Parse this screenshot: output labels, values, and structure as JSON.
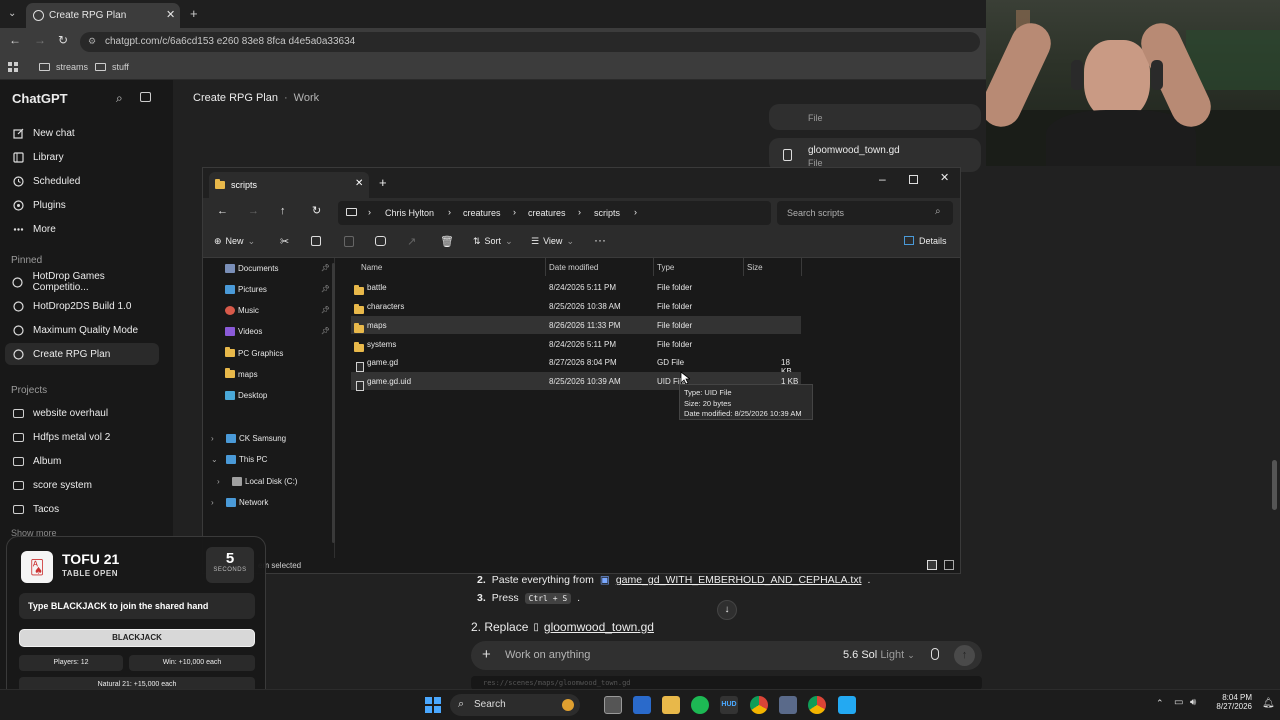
{
  "browser": {
    "tab_title": "Create RPG Plan",
    "url": "chatgpt.com/c/6a6cd153 e260 83e8 8fca d4e5a0a33634",
    "bookmarks": [
      "streams",
      "stuff"
    ]
  },
  "sidebar": {
    "app_title": "ChatGPT",
    "nav": [
      {
        "label": "New chat",
        "icon": "edit-icon"
      },
      {
        "label": "Library",
        "icon": "library-icon"
      },
      {
        "label": "Scheduled",
        "icon": "clock-icon"
      },
      {
        "label": "Plugins",
        "icon": "plugins-icon"
      },
      {
        "label": "More",
        "icon": "more-icon"
      }
    ],
    "pinned_heading": "Pinned",
    "pinned": [
      "HotDrop Games Competitio...",
      "HotDrop2DS Build 1.0",
      "Maximum Quality Mode",
      "Create RPG Plan"
    ],
    "projects_heading": "Projects",
    "projects": [
      "website overhaul",
      "Hdfps metal vol 2",
      "Album",
      "score system",
      "Tacos"
    ],
    "show_more": "Show more"
  },
  "header": {
    "title": "Create RPG Plan",
    "subtitle": "Work"
  },
  "file_cards": [
    {
      "name": "",
      "type": "File"
    },
    {
      "name": "gloomwood_town.gd",
      "type": "File"
    }
  ],
  "explorer": {
    "tab_title": "scripts",
    "breadcrumb": [
      "Chris Hylton",
      "creatures",
      "creatures",
      "scripts"
    ],
    "search_placeholder": "Search scripts",
    "commands": {
      "new": "New",
      "sort": "Sort",
      "view": "View",
      "details": "Details"
    },
    "nav_items": [
      {
        "label": "Documents",
        "color": "#7a8fb8"
      },
      {
        "label": "Pictures",
        "color": "#4a9ad8"
      },
      {
        "label": "Music",
        "color": "#d85a4a"
      },
      {
        "label": "Videos",
        "color": "#8a5ad8"
      },
      {
        "label": "PC Graphics",
        "color": "#e8b84a"
      },
      {
        "label": "maps",
        "color": "#e8b84a"
      },
      {
        "label": "Desktop",
        "color": "#4aa8d8"
      }
    ],
    "tree": [
      {
        "label": "CK Samsung",
        "color": "#4a9ad8"
      },
      {
        "label": "This PC",
        "color": "#4a9ad8"
      },
      {
        "label": "Local Disk (C:)",
        "color": "#a0a0a0"
      },
      {
        "label": "Network",
        "color": "#4a9ad8"
      }
    ],
    "columns": [
      "Name",
      "Date modified",
      "Type",
      "Size"
    ],
    "files": [
      {
        "name": "battle",
        "date": "8/24/2026 5:11 PM",
        "type": "File folder",
        "size": "",
        "folder": true
      },
      {
        "name": "characters",
        "date": "8/25/2026 10:38 AM",
        "type": "File folder",
        "size": "",
        "folder": true
      },
      {
        "name": "maps",
        "date": "8/26/2026 11:33 PM",
        "type": "File folder",
        "size": "",
        "folder": true
      },
      {
        "name": "systems",
        "date": "8/24/2026 5:11 PM",
        "type": "File folder",
        "size": "",
        "folder": true
      },
      {
        "name": "game.gd",
        "date": "8/27/2026 8:04 PM",
        "type": "GD File",
        "size": "18 KB",
        "folder": false
      },
      {
        "name": "game.gd.uid",
        "date": "8/25/2026 10:39 AM",
        "type": "UID File",
        "size": "1 KB",
        "folder": false
      }
    ],
    "tooltip": [
      "Type: UID File",
      "Size: 20 bytes",
      "Date modified: 8/25/2026 10:39 AM"
    ],
    "status": "em selected"
  },
  "chat": {
    "step2_prefix": "Paste everything from",
    "step2_file": "game_gd_WITH_EMBERHOLD_AND_CEPHALA.txt",
    "step3_prefix": "Press",
    "step3_keys": "Ctrl + S",
    "section_heading_prefix": "2. Replace",
    "section_heading_file": "gloomwood_town.gd",
    "composer_placeholder": "Work on anything",
    "model": "5.6 Sol",
    "model_mode": "Light",
    "code_preview": "res://scenes/maps/gloomwood_town.gd"
  },
  "overlay": {
    "title": "TOFU 21",
    "subtitle": "TABLE OPEN",
    "countdown": "5",
    "countdown_unit": "SECONDS",
    "prompt": "Type BLACKJACK to join the shared hand",
    "button": "BLACKJACK",
    "players": "Players: 12",
    "win": "Win: +10,000 each",
    "natural": "Natural 21: +15,000 each",
    "progress": 0.2
  },
  "taskbar": {
    "search": "Search",
    "time": "8:04 PM",
    "date": "8/27/2026"
  },
  "colors": {
    "accent": "#10a37f",
    "folder": "#e8b84a",
    "overlay_progress": "#b8f0b8"
  }
}
